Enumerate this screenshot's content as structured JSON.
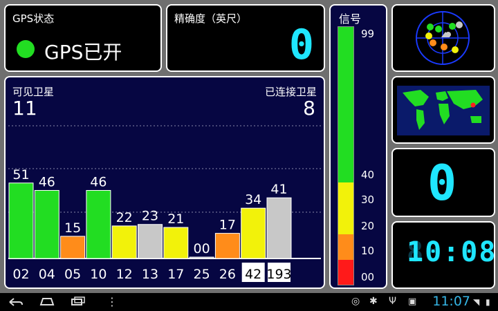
{
  "gps_status": {
    "title": "GPS状态",
    "text": "GPS已开",
    "dot_color": "#22dd22"
  },
  "accuracy": {
    "title": "精确度（英尺）",
    "value": "0"
  },
  "satellites": {
    "visible_label": "可见卫星",
    "visible_count": "11",
    "connected_label": "已连接卫星",
    "connected_count": "8"
  },
  "chart_data": {
    "type": "bar",
    "categories": [
      "02",
      "04",
      "05",
      "10",
      "12",
      "13",
      "17",
      "25",
      "26",
      "42",
      "193"
    ],
    "values": [
      51,
      46,
      15,
      46,
      22,
      23,
      21,
      0,
      17,
      34,
      41
    ],
    "value_labels": [
      "51",
      "46",
      "15",
      "46",
      "22",
      "23",
      "21",
      "00",
      "17",
      "34",
      "41"
    ],
    "colors": [
      "#22dd22",
      "#22dd22",
      "#ff8c1a",
      "#22dd22",
      "#f2f20a",
      "#c8c8c8",
      "#f2f20a",
      "#c8c8c8",
      "#ff8c1a",
      "#f2f20a",
      "#c8c8c8"
    ],
    "highlighted": [
      false,
      false,
      false,
      false,
      false,
      false,
      false,
      false,
      false,
      true,
      true
    ],
    "ylim": [
      0,
      99
    ]
  },
  "signal": {
    "title": "信号",
    "labels": [
      "99",
      "40",
      "30",
      "20",
      "10",
      "00"
    ],
    "colors": {
      "green": "#22dd22",
      "yellow": "#f2f20a",
      "orange": "#ff8c1a",
      "red": "#ff1a1a"
    }
  },
  "speed": {
    "value": "0"
  },
  "time": {
    "value": "10:08",
    "ghost": "88:88"
  },
  "navbar": {
    "clock": "11:07"
  }
}
